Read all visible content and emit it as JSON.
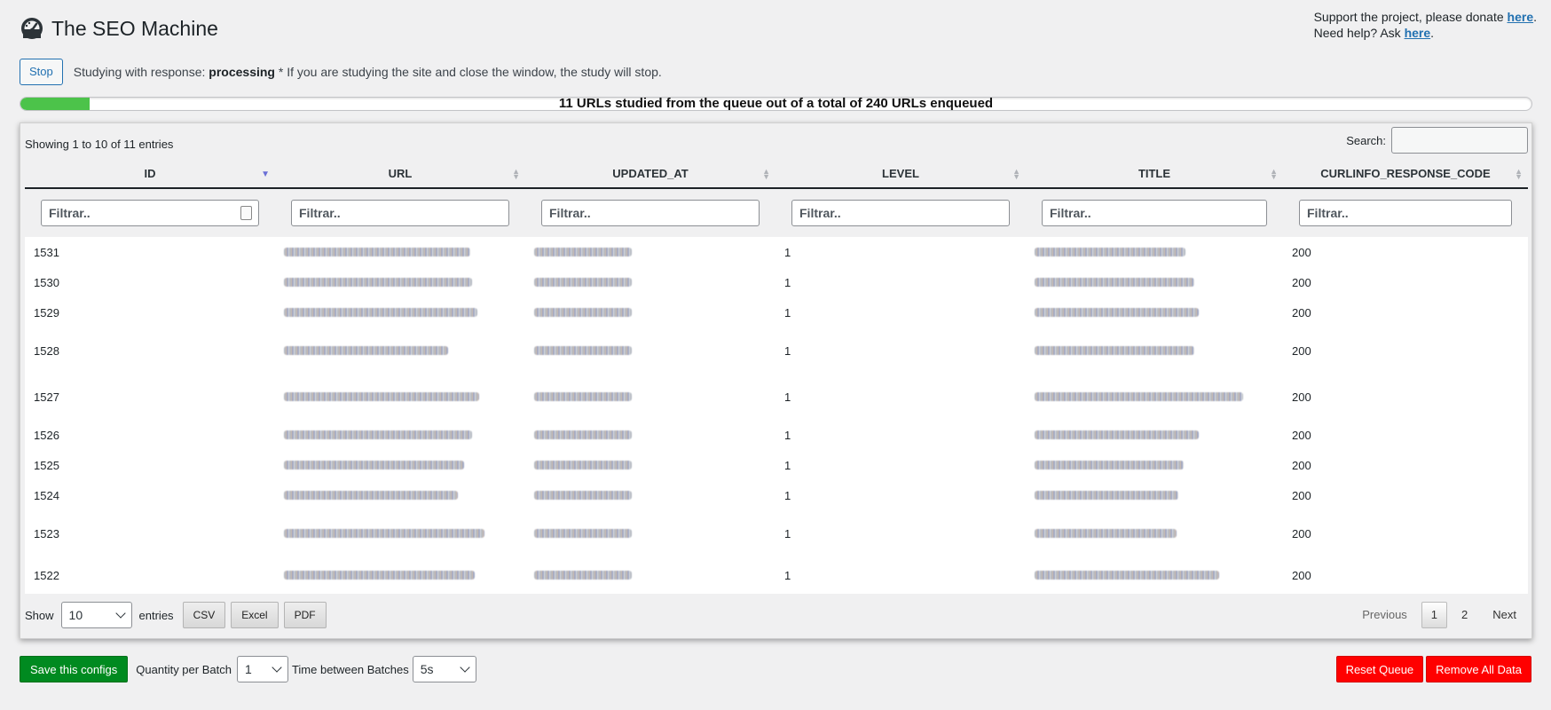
{
  "header": {
    "title": "The SEO Machine",
    "icon": "dashboard-gauge-icon"
  },
  "support": {
    "line1_prefix": "Support the project, please donate ",
    "line1_link": "here",
    "line1_suffix": ".",
    "line2_prefix": "Need help? Ask ",
    "line2_link": "here",
    "line2_suffix": "."
  },
  "status": {
    "stop_label": "Stop",
    "prefix": "Studying with response: ",
    "state": "processing",
    "note": " * If you are studying the site and close the window, the study will stop."
  },
  "progress": {
    "fraction": 0.0458,
    "label": "11 URLs studied from the queue out of a total of 240 URLs enqueued",
    "color": "#4cc34a"
  },
  "table": {
    "info": "Showing 1 to 10 of 11 entries",
    "search_label": "Search:",
    "search_value": "",
    "columns": [
      "ID",
      "URL",
      "UPDATED_AT",
      "LEVEL",
      "TITLE",
      "CURLINFO_RESPONSE_CODE"
    ],
    "sorted_column": "ID",
    "filter_placeholder": "Filtrar..",
    "rows": [
      {
        "id": "1531",
        "level": "1",
        "code": "200"
      },
      {
        "id": "1530",
        "level": "1",
        "code": "200"
      },
      {
        "id": "1529",
        "level": "1",
        "code": "200"
      },
      {
        "id": "1528",
        "level": "1",
        "code": "200"
      },
      {
        "id": "1527",
        "level": "1",
        "code": "200"
      },
      {
        "id": "1526",
        "level": "1",
        "code": "200"
      },
      {
        "id": "1525",
        "level": "1",
        "code": "200"
      },
      {
        "id": "1524",
        "level": "1",
        "code": "200"
      },
      {
        "id": "1523",
        "level": "1",
        "code": "200"
      },
      {
        "id": "1522",
        "level": "1",
        "code": "200"
      }
    ]
  },
  "bottom": {
    "show_label": "Show",
    "page_length": "10",
    "entries_label": "entries",
    "export_buttons": [
      "CSV",
      "Excel",
      "PDF"
    ],
    "previous": "Previous",
    "pages": [
      "1",
      "2"
    ],
    "current_page": "1",
    "next": "Next"
  },
  "footer": {
    "save_label": "Save this configs",
    "qty_label": "Quantity per Batch",
    "qty_value": "1",
    "time_label": "Time between Batches",
    "time_value": "5s",
    "reset_label": "Reset Queue",
    "remove_label": "Remove All Data",
    "colors": {
      "save": "#008a20",
      "danger": "#ff0000"
    }
  }
}
